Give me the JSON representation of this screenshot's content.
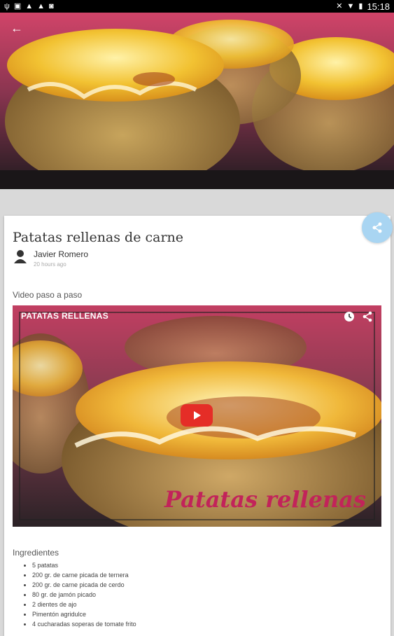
{
  "status_bar": {
    "time": "15:18",
    "left_icons": [
      "usb-icon",
      "image-icon",
      "warning-icon",
      "warning-icon",
      "photo-icon"
    ],
    "right_icons": [
      "mute-icon",
      "wifi-icon",
      "battery-icon"
    ]
  },
  "header": {
    "back_label": "←"
  },
  "recipe": {
    "title": "Patatas rellenas de carne",
    "author": "Javier Romero",
    "time_ago": "20 hours ago",
    "video_section_label": "Video paso a paso",
    "ingredients_label": "Ingredientes",
    "ingredients": [
      "5 patatas",
      "200 gr. de carne picada de ternera",
      "200 gr. de carne picada de cerdo",
      "80 gr. de jamón picado",
      "2 dientes de ajo",
      "Pimentón agridulce",
      "4 cucharadas soperas de tomate frito"
    ]
  },
  "video": {
    "title": "PATATAS RELLENAS",
    "overlay_text": "Patatas rellenas"
  },
  "colors": {
    "fab": "#a9d5f2",
    "youtube_red": "#e52d27",
    "overlay_pink": "#c2235a"
  }
}
